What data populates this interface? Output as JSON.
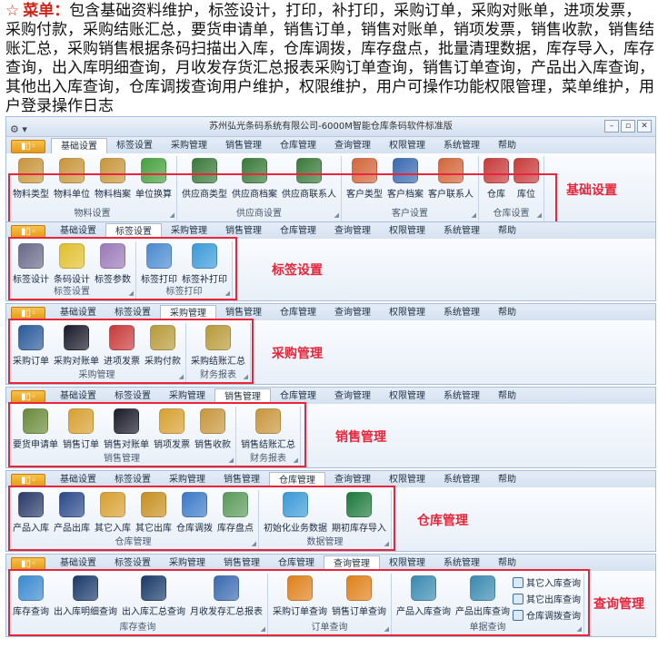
{
  "intro": {
    "star": "☆",
    "label": "菜单：",
    "text": "包含基础资料维护，标签设计，打印，补打印，采购订单，采购对账单，进项发票，采购付款，采购结账汇总，要货申请单，销售订单，销售对账单，销项发票，销售收款，销售结账汇总，采购销售根据条码扫描出入库，仓库调拨，库存盘点，批量清理数据，库存导入，库存查询，出入库明细查询，月收发存货汇总报表采购订单查询，销售订单查询，产品出入库查询，其他出入库查询，仓库调拨查询用户维护，权限维护，用户可操作功能权限管理，菜单维护，用户登录操作日志"
  },
  "window_title": "苏州弘光条码系统有限公司-6000M智能仓库条码软件标准版",
  "file_tab": "▮▯◦",
  "tabs": [
    "基础设置",
    "标签设置",
    "采购管理",
    "销售管理",
    "仓库管理",
    "查询管理",
    "权限管理",
    "系统管理",
    "帮助"
  ],
  "sections": [
    {
      "annotation": "基础设置",
      "active_tab": 0,
      "groups": [
        {
          "label": "物料设置",
          "buttons": [
            {
              "label": "物料类型",
              "icon": "material-type-icon",
              "color": "#c8963c"
            },
            {
              "label": "物料单位",
              "icon": "material-unit-icon",
              "color": "#c8963c"
            },
            {
              "label": "物料档案",
              "icon": "material-file-icon",
              "color": "#c8963c"
            },
            {
              "label": "单位换算",
              "icon": "unit-convert-icon",
              "color": "#48a040"
            }
          ]
        },
        {
          "label": "供应商设置",
          "buttons": [
            {
              "label": "供应商类型",
              "icon": "truck-icon",
              "color": "#3a7a3a"
            },
            {
              "label": "供应商档案",
              "icon": "truck-icon",
              "color": "#3a7a3a"
            },
            {
              "label": "供应商联系人",
              "icon": "truck-icon",
              "color": "#3a7a3a"
            }
          ]
        },
        {
          "label": "客户设置",
          "buttons": [
            {
              "label": "客户类型",
              "icon": "customer-icon",
              "color": "#d2663a"
            },
            {
              "label": "客户档案",
              "icon": "customer-icon",
              "color": "#3a6ab0"
            },
            {
              "label": "客户联系人",
              "icon": "customer-icon",
              "color": "#d2663a"
            }
          ]
        },
        {
          "label": "仓库设置",
          "buttons": [
            {
              "label": "仓库",
              "icon": "warehouse-icon",
              "color": "#c83a3a"
            },
            {
              "label": "库位",
              "icon": "warehouse-icon",
              "color": "#c83a3a"
            }
          ]
        }
      ]
    },
    {
      "annotation": "标签设置",
      "active_tab": 1,
      "groups": [
        {
          "label": "标签设置",
          "buttons": [
            {
              "label": "标签设计",
              "icon": "label-design-icon",
              "color": "#6a6a8a"
            },
            {
              "label": "条码设计",
              "icon": "bulb-icon",
              "color": "#e0c030"
            },
            {
              "label": "标签参数",
              "icon": "label-param-icon",
              "color": "#9a7ab8"
            }
          ]
        },
        {
          "label": "标签打印",
          "buttons": [
            {
              "label": "标签打印",
              "icon": "printer-icon",
              "color": "#4a8ad0"
            },
            {
              "label": "标签补打印",
              "icon": "reprint-icon",
              "color": "#3a9ad8"
            }
          ]
        }
      ]
    },
    {
      "annotation": "采购管理",
      "active_tab": 2,
      "groups": [
        {
          "label": "采购管理",
          "buttons": [
            {
              "label": "采购订单",
              "icon": "purchase-order-icon",
              "color": "#2a5a9a"
            },
            {
              "label": "采购对账单",
              "icon": "statement-icon",
              "color": "#1a1a2a"
            },
            {
              "label": "进项发票",
              "icon": "invoice-icon",
              "color": "#c83a3a"
            },
            {
              "label": "采购付款",
              "icon": "payment-icon",
              "color": "#b89a3a"
            }
          ]
        },
        {
          "label": "财务报表",
          "buttons": [
            {
              "label": "采购结账汇总",
              "icon": "summary-icon",
              "color": "#b89a3a"
            }
          ]
        }
      ]
    },
    {
      "annotation": "销售管理",
      "active_tab": 3,
      "groups": [
        {
          "label": "销售管理",
          "buttons": [
            {
              "label": "要货申请单",
              "icon": "request-icon",
              "color": "#6a8a3a"
            },
            {
              "label": "销售订单",
              "icon": "sales-order-icon",
              "color": "#d8a030"
            },
            {
              "label": "销售对账单",
              "icon": "statement-icon",
              "color": "#1a1a2a"
            },
            {
              "label": "销项发票",
              "icon": "invoice-icon",
              "color": "#d8a030"
            },
            {
              "label": "销售收款",
              "icon": "receipt-icon",
              "color": "#c8963c"
            }
          ]
        },
        {
          "label": "财务报表",
          "buttons": [
            {
              "label": "销售结账汇总",
              "icon": "summary-icon",
              "color": "#c8963c"
            }
          ]
        }
      ]
    },
    {
      "annotation": "仓库管理",
      "active_tab": 4,
      "groups": [
        {
          "label": "仓库管理",
          "buttons": [
            {
              "label": "产品入库",
              "icon": "inbound-icon",
              "color": "#2a3a6a"
            },
            {
              "label": "产品出库",
              "icon": "outbound-icon",
              "color": "#2a4a8a"
            },
            {
              "label": "其它入库",
              "icon": "forklift-icon",
              "color": "#d8a030"
            },
            {
              "label": "其它出库",
              "icon": "forklift-icon",
              "color": "#c89020"
            },
            {
              "label": "仓库调拨",
              "icon": "transfer-icon",
              "color": "#3a7ac8"
            },
            {
              "label": "库存盘点",
              "icon": "inventory-icon",
              "color": "#5a9a5a"
            }
          ]
        },
        {
          "label": "数据管理",
          "buttons": [
            {
              "label": "初始化业务数据",
              "icon": "init-data-icon",
              "color": "#3a9ad8"
            },
            {
              "label": "期初库存导入",
              "icon": "excel-icon",
              "color": "#1d7a3c"
            }
          ]
        }
      ]
    },
    {
      "annotation": "查询管理",
      "active_tab": 5,
      "groups": [
        {
          "label": "库存查询",
          "buttons": [
            {
              "label": "库存查询",
              "icon": "stock-query-icon",
              "color": "#3a8ad0"
            },
            {
              "label": "出入库明细查询",
              "icon": "magnifier-icon",
              "color": "#1a3a6a"
            },
            {
              "label": "出入库汇总查询",
              "icon": "magnifier-icon",
              "color": "#1a3a6a"
            },
            {
              "label": "月收发存汇总报表",
              "icon": "calendar-icon",
              "color": "#3a6ab0"
            }
          ]
        },
        {
          "label": "订单查询",
          "buttons": [
            {
              "label": "采购订单查询",
              "icon": "order-query-icon",
              "color": "#e0801a"
            },
            {
              "label": "销售订单查询",
              "icon": "order-query-icon",
              "color": "#e0801a"
            }
          ]
        },
        {
          "label": "单据查询",
          "buttons": [
            {
              "label": "产品入库查询",
              "icon": "house-query-icon",
              "color": "#3a8ab0"
            },
            {
              "label": "产品出库查询",
              "icon": "house-query-icon",
              "color": "#3a8ab0"
            }
          ],
          "smalls": [
            "其它入库查询",
            "其它出库查询",
            "仓库调拨查询"
          ]
        }
      ]
    }
  ]
}
